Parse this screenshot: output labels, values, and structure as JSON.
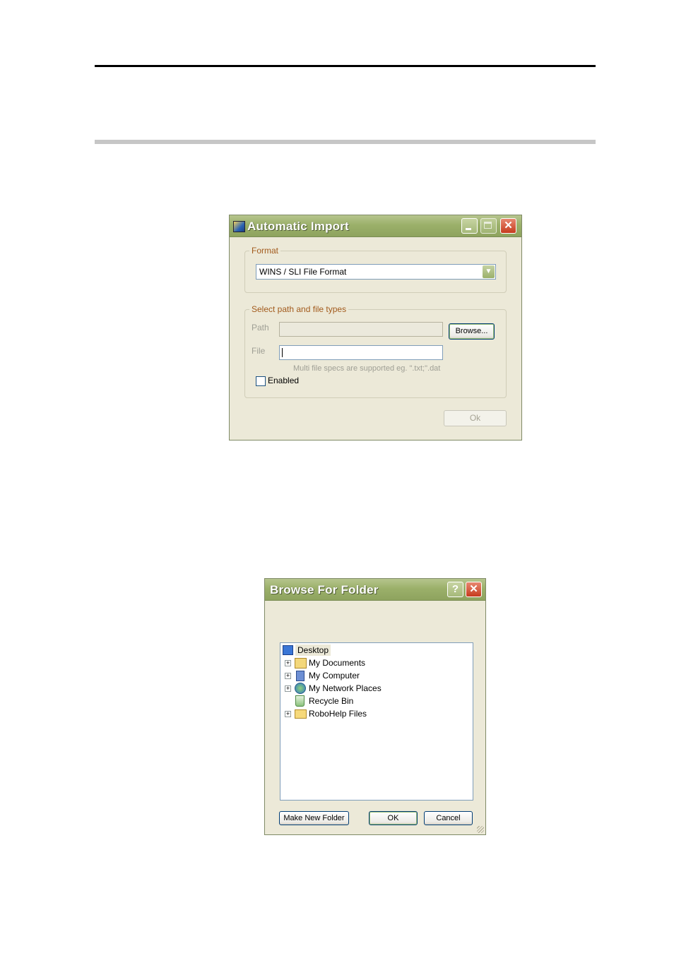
{
  "auto_import": {
    "title": "Automatic Import",
    "format": {
      "legend": "Format",
      "selected": "WINS / SLI File Format"
    },
    "path_group": {
      "legend": "Select path and file types",
      "path_label": "Path",
      "path_value": "",
      "browse_label": "Browse...",
      "file_label": "File",
      "file_value": "",
      "hint": "Multi file specs are supported eg. \".txt;\".dat",
      "enabled_label": "Enabled",
      "enabled_checked": false
    },
    "ok_label": "Ok"
  },
  "browse_folder": {
    "title": "Browse For Folder",
    "tree": {
      "root": "Desktop",
      "items": [
        {
          "label": "My Documents",
          "icon": "my-documents-icon",
          "expandable": true
        },
        {
          "label": "My Computer",
          "icon": "my-computer-icon",
          "expandable": true
        },
        {
          "label": "My Network Places",
          "icon": "network-places-icon",
          "expandable": true
        },
        {
          "label": "Recycle Bin",
          "icon": "recycle-bin-icon",
          "expandable": false
        },
        {
          "label": "RoboHelp Files",
          "icon": "folder-icon",
          "expandable": true
        }
      ]
    },
    "make_new_folder_label": "Make New Folder",
    "ok_label": "OK",
    "cancel_label": "Cancel"
  }
}
